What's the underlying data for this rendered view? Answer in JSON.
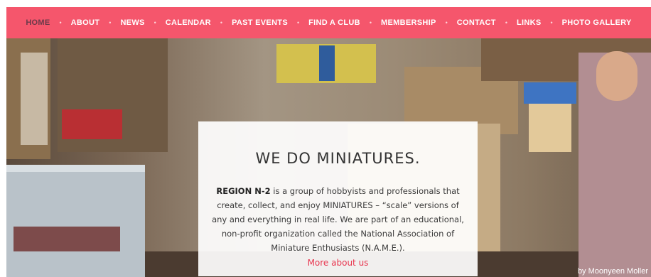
{
  "nav": {
    "items": [
      {
        "label": "HOME"
      },
      {
        "label": "ABOUT"
      },
      {
        "label": "NEWS"
      },
      {
        "label": "CALENDAR"
      },
      {
        "label": "PAST EVENTS"
      },
      {
        "label": "FIND A CLUB"
      },
      {
        "label": "MEMBERSHIP"
      },
      {
        "label": "CONTACT"
      },
      {
        "label": "LINKS"
      },
      {
        "label": "PHOTO GALLERY"
      }
    ],
    "separator": "•",
    "colors": {
      "bar": "#f5566c",
      "active_text": "#6b3a4a",
      "text": "#ffffff"
    }
  },
  "hero": {
    "title": "WE DO MINIATURES.",
    "body_strong": "REGION N-2",
    "body_text": " is a group of hobbyists and professionals that create, collect, and enjoy MINIATURES – “scale” versions of any and everything in real life. We are part of an educational, non-profit organization called the National Association of Miniature Enthusiasts (N.A.M.E.).",
    "link_label": "More about us",
    "link_color": "#e8364f",
    "photo_credit": "by Moonyeen Moller"
  }
}
